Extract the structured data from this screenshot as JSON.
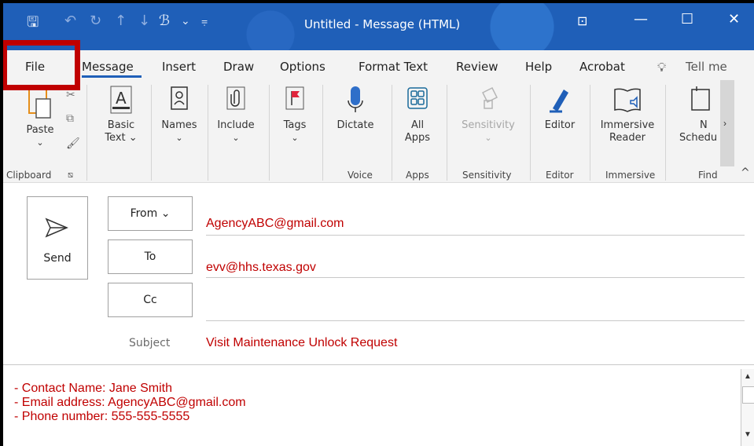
{
  "titlebar": {
    "title": "Untitled  -  Message (HTML)",
    "icons": [
      "save-icon",
      "undo-icon",
      "redo-icon",
      "up-arrow-icon",
      "down-arrow-icon",
      "paragraph-icon",
      "chevron-down-icon",
      "customize-icon",
      "restore-icon",
      "minimize-icon",
      "maximize-icon",
      "close-icon"
    ]
  },
  "tabs": [
    {
      "label": "File"
    },
    {
      "label": "Message"
    },
    {
      "label": "Insert"
    },
    {
      "label": "Draw"
    },
    {
      "label": "Options"
    },
    {
      "label": "Format Text"
    },
    {
      "label": "Review"
    },
    {
      "label": "Help"
    },
    {
      "label": "Acrobat"
    },
    {
      "label": "Tell me"
    }
  ],
  "ribbon": {
    "paste": "Paste",
    "basic_text": "Basic",
    "basic_text2": "Text ⌄",
    "names": "Names",
    "include": "Include",
    "tags": "Tags",
    "dictate": "Dictate",
    "all_apps": "All",
    "all_apps2": "Apps",
    "sensitivity": "Sensitivity",
    "editor": "Editor",
    "immersive_reader": "Immersive",
    "immersive_reader2": "Reader",
    "schedule": "Schedu",
    "next_partial": "N",
    "groups": {
      "clipboard": "Clipboard",
      "voice": "Voice",
      "apps": "Apps",
      "sensitivity": "Sensitivity",
      "editor": "Editor",
      "immersive": "Immersive",
      "find": "Find"
    }
  },
  "compose": {
    "send": "Send",
    "from_label": "From ⌄",
    "to_label": "To",
    "cc_label": "Cc",
    "subject_label": "Subject",
    "from_value": "AgencyABC@gmail.com",
    "to_value": "evv@hhs.texas.gov",
    "cc_value": "",
    "subject_value": "Visit Maintenance Unlock Request"
  },
  "body": {
    "lines": [
      "- Contact Name: Jane Smith",
      "- Email address: AgencyABC@gmail.com",
      "- Phone number: 555-555-5555"
    ]
  },
  "colors": {
    "accent": "#1f5fb8",
    "highlight": "#c00000",
    "text_red": "#c00000"
  }
}
